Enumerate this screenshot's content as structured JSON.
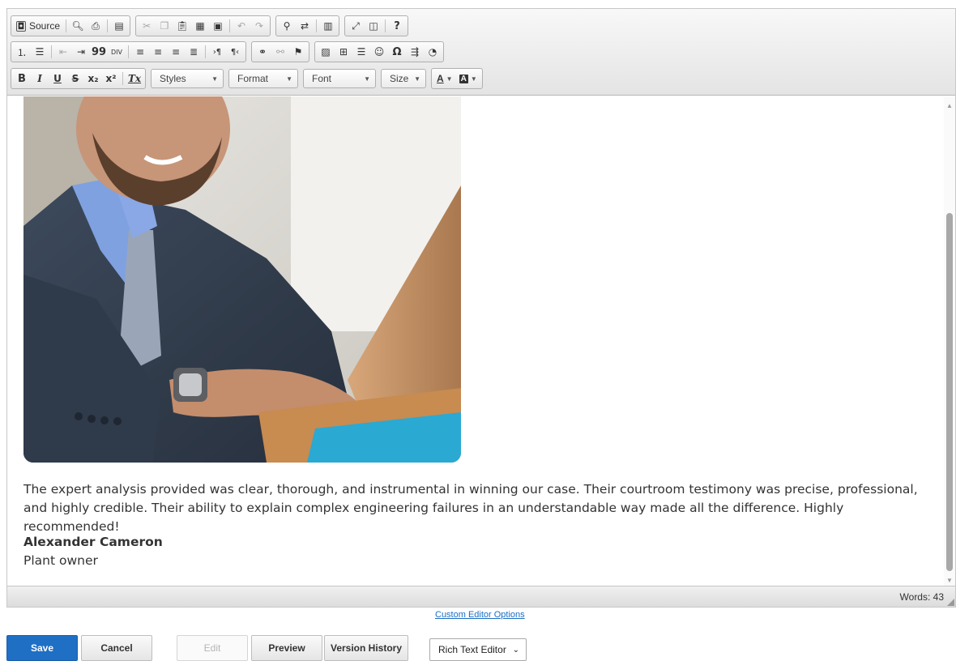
{
  "toolbar": {
    "row1": {
      "source_label": "Source",
      "help_label": "?"
    },
    "row2": {
      "quote_label": "99"
    },
    "row3": {
      "bold": "B",
      "italic": "I",
      "underline": "U",
      "strike": "S",
      "subscript": "x₂",
      "superscript": "x²",
      "remove_format": "Tx",
      "styles": "Styles",
      "format": "Format",
      "font": "Font",
      "size": "Size",
      "text_color": "A",
      "bg_color": "A"
    }
  },
  "content": {
    "image_alt": "Smiling man in a dark suit working on a laptop",
    "paragraph": "The expert analysis provided was clear, thorough, and instrumental in winning our case. Their courtroom testimony was precise, professional, and highly credible. Their ability to explain complex engineering failures in an understandable way made all the difference. Highly recommended!",
    "author_name": "Alexander Cameron",
    "author_role": "Plant owner"
  },
  "status": {
    "words": "Words: 43"
  },
  "links": {
    "custom_options": "Custom Editor Options"
  },
  "actions": {
    "save": "Save",
    "cancel": "Cancel",
    "edit": "Edit",
    "preview": "Preview",
    "version_history": "Version History",
    "editor_mode": "Rich Text Editor"
  },
  "colors": {
    "primary": "#1f6fc5",
    "link": "#1a6ec4",
    "text": "#333333"
  },
  "icons": {
    "toolbar": [
      "source-icon",
      "preview-icon",
      "print-icon",
      "templates-icon",
      "cut-icon",
      "copy-icon",
      "paste-icon",
      "paste-text-icon",
      "paste-word-icon",
      "undo-icon",
      "redo-icon",
      "find-icon",
      "replace-icon",
      "select-all-icon",
      "maximize-icon",
      "show-blocks-icon",
      "help-icon"
    ]
  }
}
